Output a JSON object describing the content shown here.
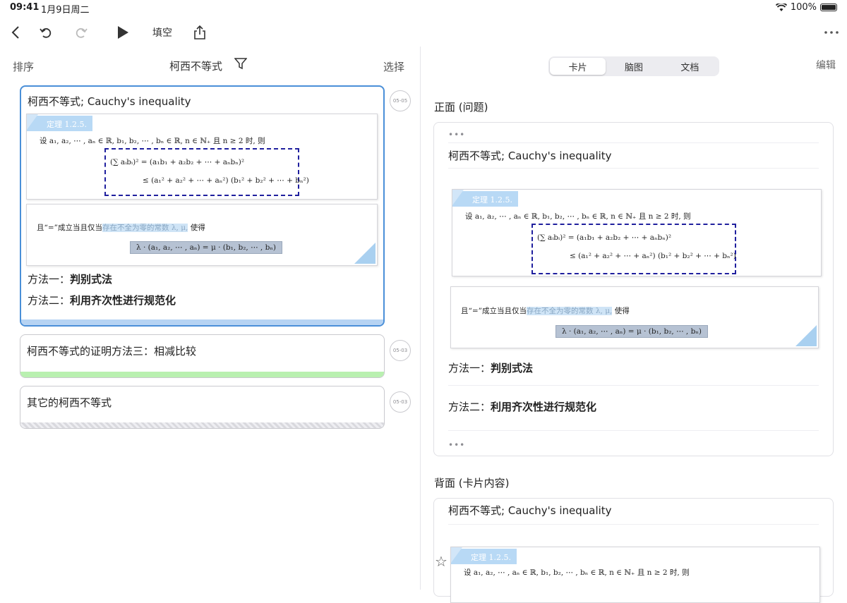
{
  "status": {
    "time": "09:41",
    "date": "1月9日周二",
    "battery": "100%"
  },
  "toolbar": {
    "fill_blank_label": "填空"
  },
  "list_header": {
    "sort_label": "排序",
    "title": "柯西不等式",
    "select_label": "选择"
  },
  "cards": [
    {
      "title": "柯西不等式; Cauchy's inequality",
      "date": "05-05",
      "theorem": {
        "tag": "定理 1.2.5.",
        "statement": "设 a₁, a₂, ⋯ , aₙ ∈ ℝ, b₁, b₂, ⋯ , bₙ ∈ ℝ, n ∈ ℕ₊ 且 n ≥ 2 时, 则",
        "ineq_line1": "(∑ aᵢbᵢ)² = (a₁b₁ + a₂b₂ + ⋯ + aₙbₙ)²",
        "ineq_line2": "≤ (a₁² + a₂² + ⋯ + aₙ²) (b₁² + b₂² + ⋯ + bₙ²)",
        "cond_prefix": "且“=”成立当且仅当",
        "cond_highlight": "存在不全为零的常数 λ, μ,",
        "cond_suffix": " 使得",
        "equality": "λ · (a₁, a₂, ⋯ , aₙ) = μ · (b₁, b₂, ⋯ , bₙ)"
      },
      "method1_prefix": "方法一：",
      "method1": "判别式法",
      "method2_prefix": "方法二：",
      "method2": "利用齐次性进行规范化"
    },
    {
      "title": "柯西不等式的证明方法三：相减比较",
      "date": "05-03"
    },
    {
      "title": "其它的柯西不等式",
      "date": "05-03"
    }
  ],
  "tabs": [
    {
      "label": "卡片",
      "selected": true
    },
    {
      "label": "脑图",
      "selected": false
    },
    {
      "label": "文档",
      "selected": false
    }
  ],
  "edit_label": "编辑",
  "front": {
    "label": "正面 (问题)",
    "dots": "•••"
  },
  "back": {
    "label": "背面 (卡片内容)"
  },
  "colors": {
    "accent": "#4a8fd8",
    "bar_blue": "#b6d3f3",
    "bar_green": "#b9f0b0",
    "tag_blue": "#b8d9f5",
    "box_dash": "#1f1f9e"
  }
}
